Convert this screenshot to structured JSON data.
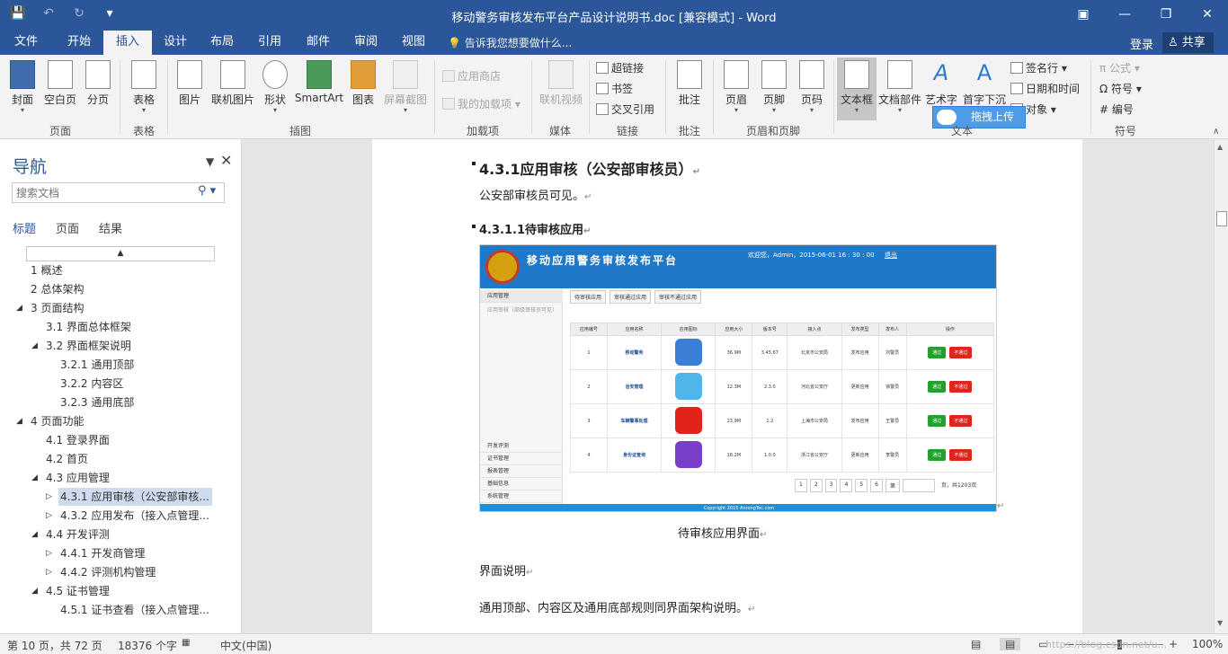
{
  "window": {
    "title": "移动警务审核发布平台产品设计说明书.doc [兼容模式] - Word",
    "controls": {
      "ribbon_options": "▣",
      "minimize": "—",
      "restore": "❐",
      "close": "✕"
    }
  },
  "qat": {
    "save": "💾",
    "undo": "↶",
    "redo": "↻",
    "customize": "▾"
  },
  "tabs": [
    "文件",
    "开始",
    "插入",
    "设计",
    "布局",
    "引用",
    "邮件",
    "审阅",
    "视图"
  ],
  "active_tab": "插入",
  "tell_me": "💡 告诉我您想要做什么...",
  "login": "登录",
  "share": "♙ 共享",
  "ribbon": {
    "pages": {
      "label": "页面",
      "cover": "封面",
      "blank": "空白页",
      "break": "分页"
    },
    "tables": {
      "label": "表格",
      "table": "表格"
    },
    "illustrations": {
      "label": "插图",
      "picture": "图片",
      "online_picture": "联机图片",
      "shapes": "形状",
      "smartart": "SmartArt",
      "chart": "图表",
      "screenshot": "屏幕截图"
    },
    "addins": {
      "label": "加载项",
      "store": "应用商店",
      "my_addins": "我的加载项"
    },
    "media": {
      "label": "媒体",
      "online_video": "联机视频"
    },
    "links": {
      "label": "链接",
      "hyperlink": "超链接",
      "bookmark": "书签",
      "cross_ref": "交叉引用"
    },
    "comments": {
      "label": "批注",
      "comment": "批注"
    },
    "header_footer": {
      "label": "页眉和页脚",
      "header": "页眉",
      "footer": "页脚",
      "page_number": "页码"
    },
    "text": {
      "label": "文本",
      "textbox": "文本框",
      "parts": "文档部件",
      "wordart": "艺术字",
      "dropcap": "首字下沉",
      "signature": "签名行",
      "datetime": "日期和时间",
      "object": "对象"
    },
    "symbols": {
      "label": "符号",
      "equation": "π 公式",
      "symbol": "Ω 符号",
      "number": "# 编号"
    },
    "upload": "拖拽上传"
  },
  "nav": {
    "title": "导航",
    "search_placeholder": "搜索文档",
    "tabs": [
      "标题",
      "页面",
      "结果"
    ],
    "headings": [
      {
        "text": "1 概述",
        "level": 1,
        "tw": ""
      },
      {
        "text": "2 总体架构",
        "level": 1,
        "tw": ""
      },
      {
        "text": "3 页面结构",
        "level": 1,
        "tw": "◢"
      },
      {
        "text": "3.1 界面总体框架",
        "level": 2,
        "tw": ""
      },
      {
        "text": "3.2 界面框架说明",
        "level": 2,
        "tw": "◢"
      },
      {
        "text": "3.2.1 通用顶部",
        "level": 3,
        "tw": ""
      },
      {
        "text": "3.2.2 内容区",
        "level": 3,
        "tw": ""
      },
      {
        "text": "3.2.3 通用底部",
        "level": 3,
        "tw": ""
      },
      {
        "text": "4 页面功能",
        "level": 1,
        "tw": "◢"
      },
      {
        "text": "4.1 登录界面",
        "level": 2,
        "tw": ""
      },
      {
        "text": "4.2 首页",
        "level": 2,
        "tw": ""
      },
      {
        "text": "4.3 应用管理",
        "level": 2,
        "tw": "◢"
      },
      {
        "text": "4.3.1 应用审核（公安部审核...",
        "level": 3,
        "tw": "▷",
        "selected": true
      },
      {
        "text": "4.3.2 应用发布（接入点管理...",
        "level": 3,
        "tw": "▷"
      },
      {
        "text": "4.4 开发评测",
        "level": 2,
        "tw": "◢"
      },
      {
        "text": "4.4.1 开发商管理",
        "level": 3,
        "tw": "▷"
      },
      {
        "text": "4.4.2 评测机构管理",
        "level": 3,
        "tw": "▷"
      },
      {
        "text": "4.5 证书管理",
        "level": 2,
        "tw": "◢"
      },
      {
        "text": "4.5.1 证书查看（接入点管理...",
        "level": 3,
        "tw": ""
      }
    ]
  },
  "doc": {
    "h1": "4.3.1应用审核（公安部审核员）",
    "p1": "公安部审核员可见。",
    "h2": "4.3.1.1待审核应用",
    "caption": "待审核应用界面",
    "p2": "界面说明",
    "p3": "通用顶部、内容区及通用底部规则同界面架构说明。",
    "para_mark": "↵"
  },
  "screenshot": {
    "title": "移动应用警务审核发布平台",
    "welcome": "欢迎您，Admin，2015-06-01 16 : 30 : 00",
    "logout": "退出",
    "side_top": [
      "应用管理",
      "应用审核（部级审核员可见）"
    ],
    "side_bottom": [
      "开发评测",
      "证书管理",
      "报表管理",
      "基础信息",
      "系统管理"
    ],
    "tabs": [
      "待审核应用",
      "审核通过应用",
      "审核不通过应用"
    ],
    "columns": [
      "应用编号",
      "应用名称",
      "应用图标",
      "应用大小",
      "版本号",
      "接入点",
      "发布类型",
      "发布人",
      "操作"
    ],
    "rows": [
      {
        "id": "1",
        "name": "移动警务",
        "icon_color": "#3a7fd5",
        "size": "36.9M",
        "ver": "3.45.67",
        "point": "北京市公安局",
        "type": "发布应用",
        "person": "刘警员"
      },
      {
        "id": "2",
        "name": "治安管理",
        "icon_color": "#4fb6ea",
        "size": "12.3M",
        "ver": "2.3.0",
        "point": "河北省公安厅",
        "type": "更新应用",
        "person": "徐警员"
      },
      {
        "id": "3",
        "name": "车辆警事处理",
        "icon_color": "#e2231a",
        "size": "23.9M",
        "ver": "1.2",
        "point": "上海市公安局",
        "type": "发布应用",
        "person": "王警员"
      },
      {
        "id": "4",
        "name": "身份证查询",
        "icon_color": "#7a3fc8",
        "size": "18.2M",
        "ver": "1.0.0",
        "point": "浙江省公安厅",
        "type": "更新应用",
        "person": "李警员"
      }
    ],
    "ok_label": "通过",
    "reject_label": "不通过",
    "pager": [
      "1",
      "2",
      "3",
      "4",
      "5",
      "6",
      "第",
      "页，共1203页"
    ],
    "footer": "Copyright 2015 AnrongTec.com"
  },
  "status": {
    "page": "第 10 页，共 72 页",
    "words": "18376 个字",
    "lang": "中文(中国)",
    "zoom": "100%",
    "watermark": "https://blog.csdn.net/u..."
  }
}
